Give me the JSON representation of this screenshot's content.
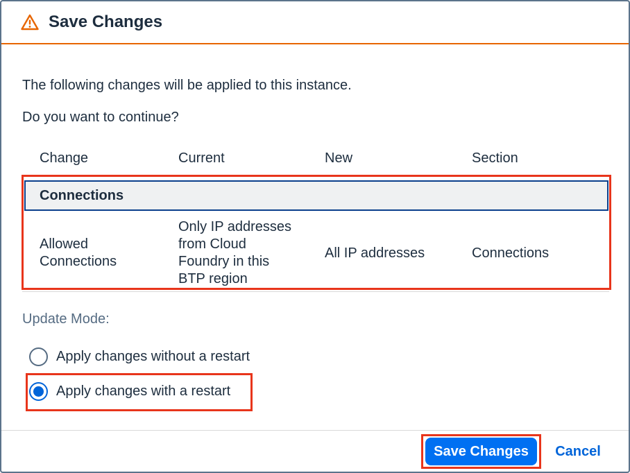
{
  "dialog": {
    "title": "Save Changes",
    "icon": "warning-icon"
  },
  "message": {
    "line1": "The following changes will be applied to this instance.",
    "line2": "Do you want to continue?"
  },
  "table": {
    "columns": [
      "Change",
      "Current",
      "New",
      "Section"
    ],
    "group": "Connections",
    "rows": [
      {
        "change": [
          "Allowed",
          "Connections"
        ],
        "current": [
          "Only IP addresses",
          "from Cloud",
          "Foundry in this",
          "BTP region"
        ],
        "new": "All IP addresses",
        "section": "Connections"
      }
    ]
  },
  "update_mode": {
    "label": "Update Mode:",
    "options": [
      {
        "label": "Apply changes without a restart",
        "selected": false
      },
      {
        "label": "Apply changes with a restart",
        "selected": true
      }
    ]
  },
  "footer": {
    "save_label": "Save Changes",
    "cancel_label": "Cancel"
  },
  "colors": {
    "accent": "#0070f2",
    "warning": "#e76500",
    "highlight": "#e8351b",
    "group_border": "#0a3f8c"
  }
}
